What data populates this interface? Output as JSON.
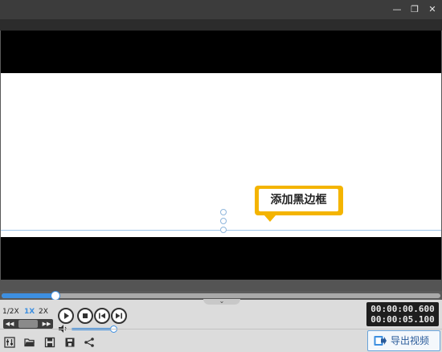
{
  "window": {
    "min_icon": "minimize-icon",
    "max_icon": "restore-icon",
    "close_icon": "close-icon",
    "min_glyph": "—",
    "max_glyph": "❐",
    "close_glyph": "✕"
  },
  "canvas": {
    "callout_text": "添加黑边框",
    "callout_color": "#f4b400"
  },
  "playback": {
    "progress_fraction": 0.12,
    "speeds": [
      "1/2X",
      "1X",
      "2X"
    ],
    "active_speed": "1X",
    "volume_fraction": 1.0,
    "current_time": "00:00:00.600",
    "total_time": "00:00:05.100"
  },
  "footer": {
    "icons": [
      "settings-icon",
      "open-folder-icon",
      "save-icon",
      "save-as-icon",
      "share-icon"
    ],
    "export_label": "导出视频"
  },
  "colors": {
    "accent": "#3d8fe0",
    "callout": "#f4b400",
    "letterbox": "#000000"
  }
}
